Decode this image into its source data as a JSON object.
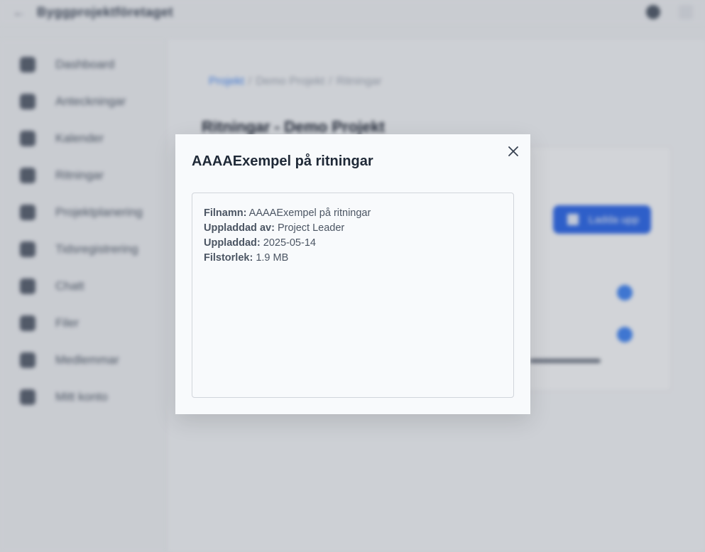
{
  "background": {
    "topbar": {
      "brand": "Byggprojektföretaget"
    },
    "sidebar": {
      "items": [
        {
          "label": "Dashboard",
          "icon": "dashboard-icon"
        },
        {
          "label": "Anteckningar",
          "icon": "notes-icon"
        },
        {
          "label": "Kalender",
          "icon": "calendar-icon"
        },
        {
          "label": "Ritningar",
          "icon": "drawings-icon"
        },
        {
          "label": "Projektplanering",
          "icon": "planning-icon"
        },
        {
          "label": "Tidsregistrering",
          "icon": "time-icon"
        },
        {
          "label": "Chatt",
          "icon": "chat-icon"
        },
        {
          "label": "Filer",
          "icon": "files-icon"
        },
        {
          "label": "Medlemmar",
          "icon": "members-icon"
        },
        {
          "label": "Mitt konto",
          "icon": "account-icon"
        }
      ]
    },
    "breadcrumb": [
      "Projekt",
      "Demo Projekt",
      "Ritningar"
    ],
    "page_title": "Ritningar - Demo Projekt",
    "upload_label": "Ladda upp"
  },
  "modal": {
    "title": "AAAAExempel på ritningar",
    "close_icon": "close-icon",
    "fields": [
      {
        "key": "Filnamn:",
        "value": "AAAAExempel på ritningar"
      },
      {
        "key": "Uppladdad av:",
        "value": "Project Leader"
      },
      {
        "key": "Uppladdad:",
        "value": "2025-05-14"
      },
      {
        "key": "Filstorlek:",
        "value": "1.9 MB"
      }
    ]
  }
}
